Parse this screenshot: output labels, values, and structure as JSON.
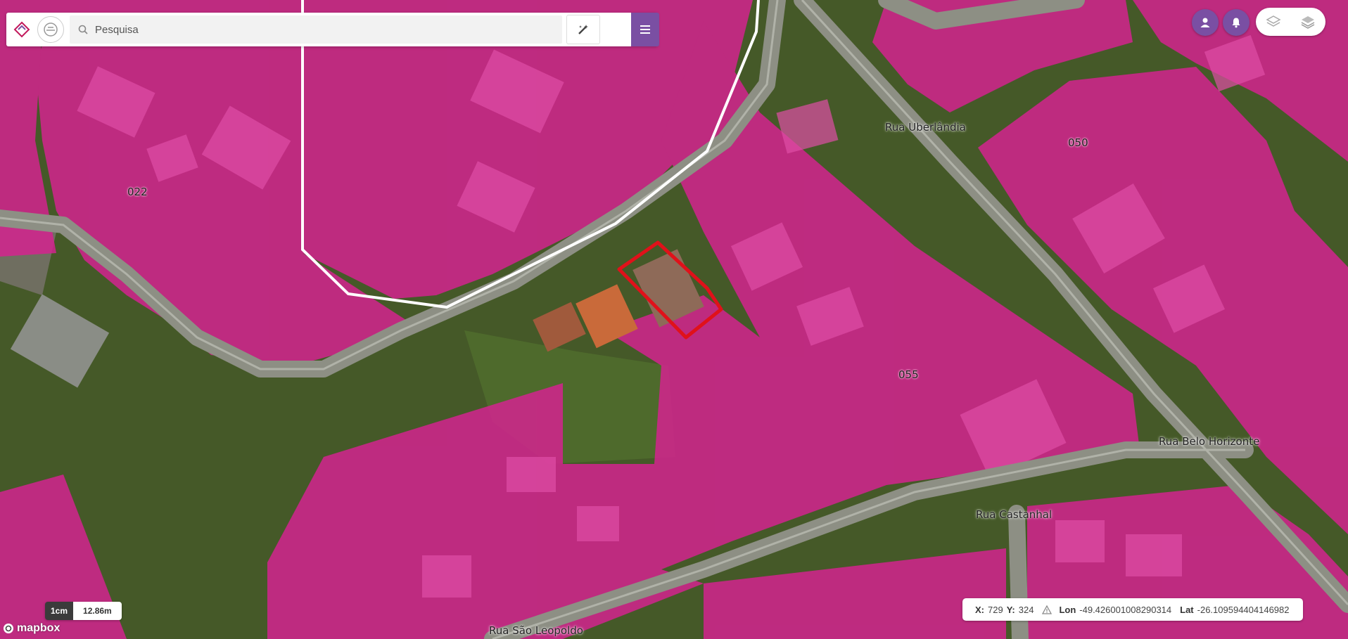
{
  "search": {
    "placeholder": "Pesquisa"
  },
  "parcels": {
    "labels": [
      "022",
      "050",
      "055"
    ]
  },
  "streets": [
    "Rua Uberlândia",
    "Rua Belo Horizonte",
    "Rua Castanhal",
    "Rua São Leopoldo"
  ],
  "scale": {
    "unit": "1cm",
    "value": "12.86m"
  },
  "attribution": {
    "text": "mapbox"
  },
  "coords": {
    "x_label": "X:",
    "x": "729",
    "y_label": "Y:",
    "y": "324",
    "lon_label": "Lon",
    "lon": "-49.426001008290314",
    "lat_label": "Lat",
    "lat": "-26.109594404146982"
  },
  "colors": {
    "parcel_fill": "#d4238f",
    "accent": "#7a4fa3",
    "selection": "#e0111a",
    "road": "#8a8a7c",
    "vegetation": "#3b5a22"
  },
  "icons": {
    "search": "search-icon",
    "tools": "magic-tools-icon",
    "menu": "hamburger-menu-icon",
    "user": "user-icon",
    "bell": "bell-icon",
    "layers_a": "layers-outline-icon",
    "layers_b": "layers-icon",
    "warning": "warning-icon"
  }
}
